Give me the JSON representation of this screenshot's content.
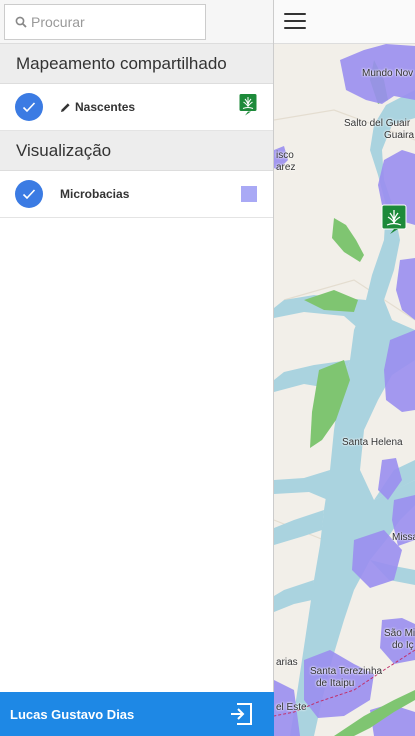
{
  "search": {
    "placeholder": "Procurar",
    "icon": "search-icon"
  },
  "sections": [
    {
      "title": "Mapeamento compartilhado",
      "layers": [
        {
          "label": "Nascentes",
          "checked": true,
          "edit_icon": "pencil-icon",
          "legend": "nascentes-marker-icon"
        }
      ]
    },
    {
      "title": "Visualização",
      "layers": [
        {
          "label": "Microbacias",
          "checked": true,
          "legend_color": "#a9a9f5"
        }
      ]
    }
  ],
  "footer": {
    "user_name": "Lucas Gustavo Dias",
    "logout_icon": "logout-icon"
  },
  "map": {
    "menu_icon": "hamburger-icon",
    "labels": [
      "Mundo Nov",
      "Salto del Guair",
      "Guaira",
      "isco",
      "arez",
      "Santa Helena",
      "Missa",
      "São Mi",
      "do Iç",
      "arias",
      "Santa Terezinha",
      "de Itaipu",
      "el Este"
    ],
    "colors": {
      "land": "#f2efe9",
      "water": "#aad3df",
      "microbacia": "#9a8ef0",
      "forest": "#7fc571",
      "marker": "#1d8a3a",
      "accent": "#1e88e5"
    }
  }
}
